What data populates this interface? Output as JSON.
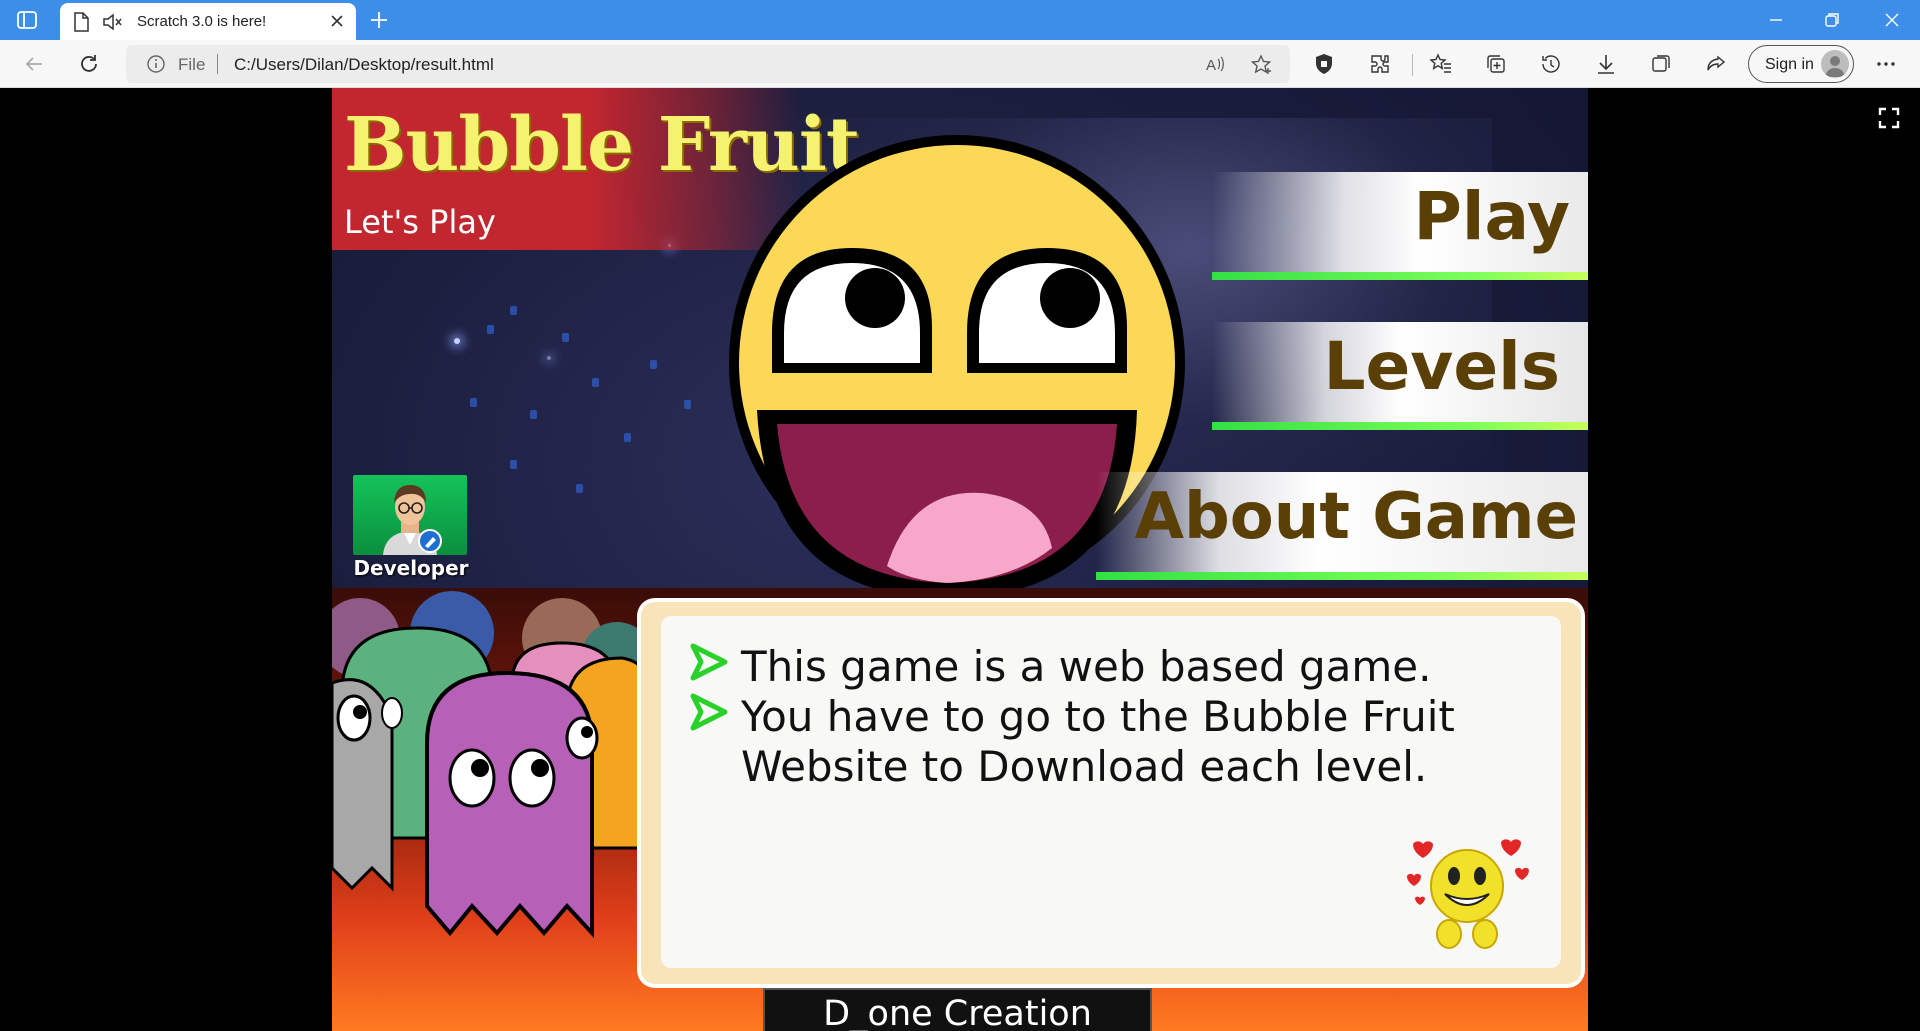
{
  "browser": {
    "tab_title": "Scratch 3.0 is here!",
    "address": {
      "scheme_label": "File",
      "url": "C:/Users/Dilan/Desktop/result.html"
    },
    "sign_in_label": "Sign in"
  },
  "game": {
    "title": "Bubble Fruit",
    "subtitle": "Let's Play",
    "menu": {
      "play": "Play",
      "levels": "Levels",
      "about": "About Game"
    },
    "developer_label": "Developer",
    "info": {
      "line1": "This game is a web based game.",
      "line2": "You have to go to the Bubble Fruit",
      "line3": "Website to Download each level."
    },
    "credit": "D_one Creation"
  },
  "colors": {
    "titlebar": "#3d8ee8",
    "title_yellow": "#f4f26e",
    "menu_text": "#5a3f06",
    "menu_line": "#33e044",
    "title_band": "#c2262f"
  }
}
